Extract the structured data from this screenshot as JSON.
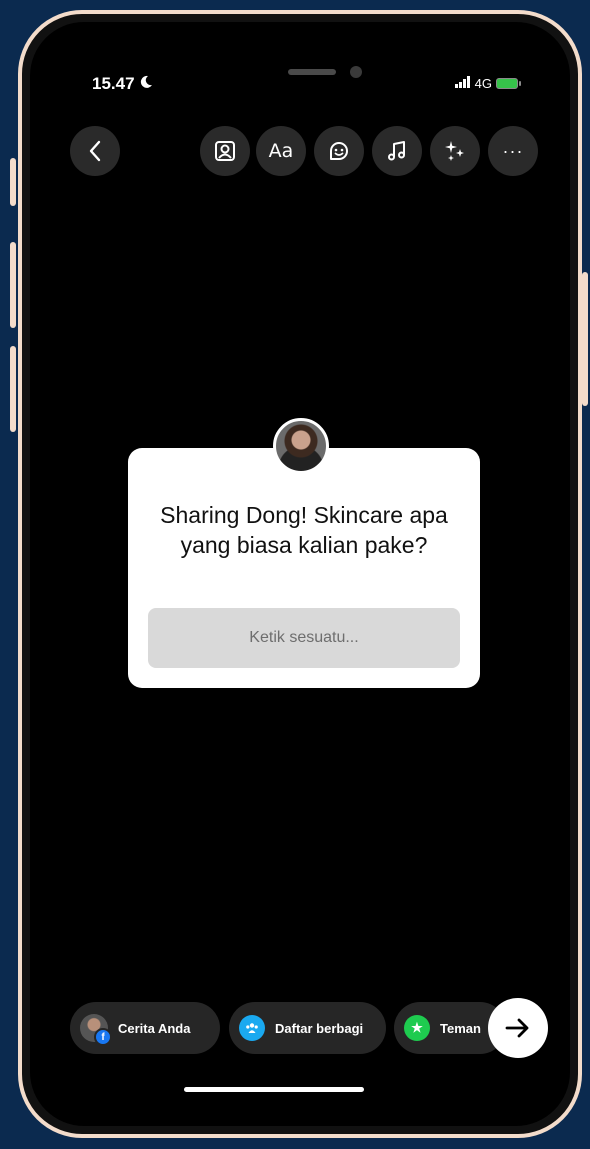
{
  "status": {
    "time": "15.47",
    "network": "4G"
  },
  "toolbar": {
    "text_label": "Aa",
    "more_label": "···"
  },
  "question_card": {
    "question": "Sharing Dong! Skincare apa yang biasa kalian pake?",
    "answer_placeholder": "Ketik sesuatu..."
  },
  "share_targets": [
    {
      "label": "Cerita Anda",
      "icon": "profile-avatar"
    },
    {
      "label": "Daftar berbagi",
      "icon": "group-icon",
      "color": "#1aa9f0"
    },
    {
      "label": "Teman",
      "icon": "star-icon",
      "color": "#1ecb4f"
    }
  ],
  "colors": {
    "page_background": "#0b2a4f",
    "phone_frame": "#f3dccb",
    "input_background": "#d9d9d9"
  }
}
